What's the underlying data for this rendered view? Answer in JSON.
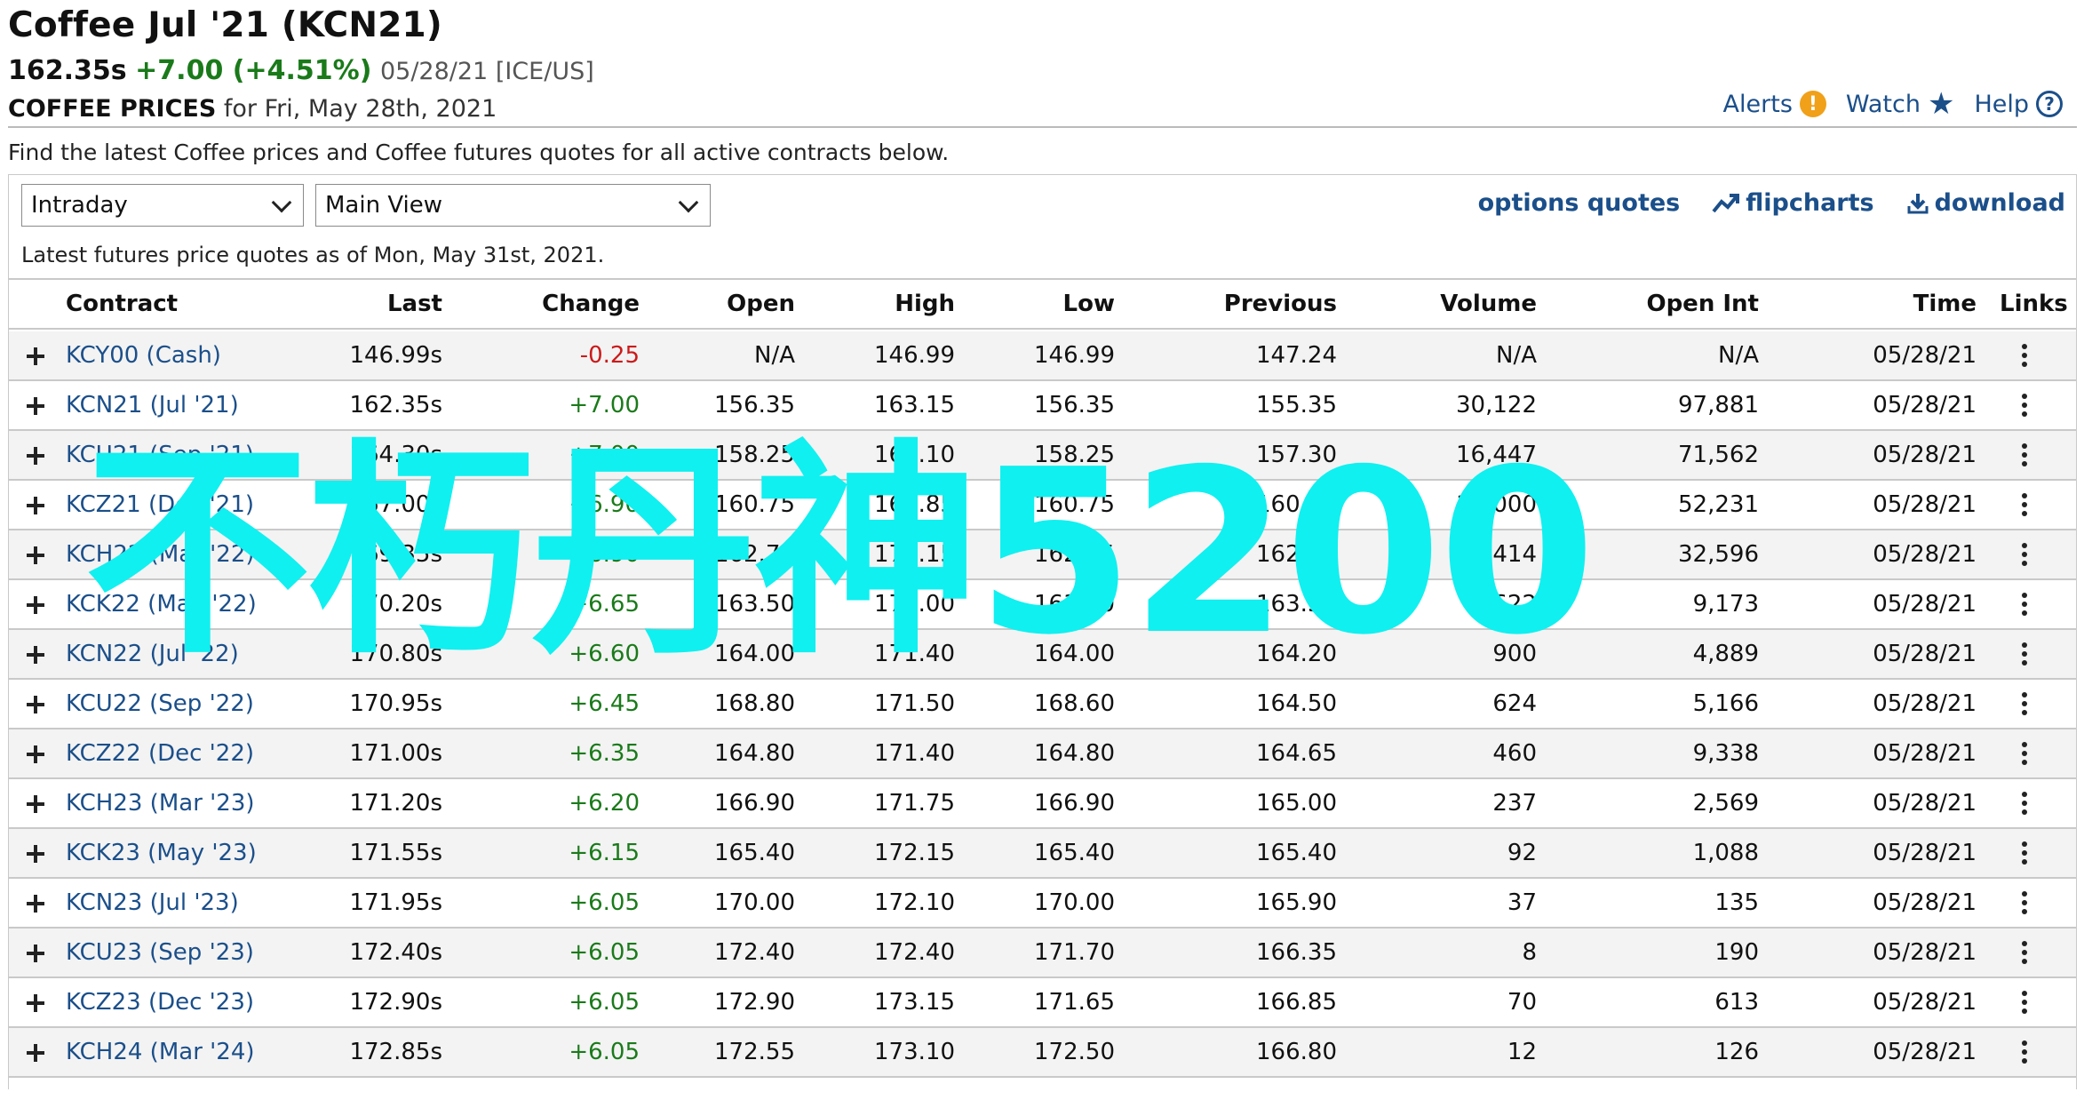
{
  "header": {
    "title": "Coffee Jul '21 (KCN21)",
    "last": "162.35s",
    "change": "+7.00 (+4.51%)",
    "meta": "05/28/21 [ICE/US]",
    "prices_label": "COFFEE PRICES",
    "prices_date": "for Fri, May 28th, 2021",
    "alerts_label": "Alerts",
    "alerts_glyph": "!",
    "watch_label": "Watch",
    "help_label": "Help",
    "help_glyph": "?",
    "description": "Find the latest Coffee prices and Coffee futures quotes for all active contracts below."
  },
  "controls": {
    "period_select": "Intraday",
    "view_select": "Main View",
    "options_quotes": "options quotes",
    "flipcharts": "flipcharts",
    "download": "download",
    "as_of": "Latest futures price quotes as of Mon, May 31st, 2021."
  },
  "colors": {
    "link_blue": "#1b4f8a",
    "positive": "#1a7a1a",
    "negative": "#cc1a1a",
    "alert_orange": "#f0a019",
    "watermark": "#10f0f0"
  },
  "table": {
    "columns": [
      "Contract",
      "Last",
      "Change",
      "Open",
      "High",
      "Low",
      "Previous",
      "Volume",
      "Open Int",
      "Time",
      "Links"
    ],
    "rows": [
      {
        "contract": "KCY00 (Cash)",
        "last": "146.99s",
        "change": "-0.25",
        "open": "N/A",
        "high": "146.99",
        "low": "146.99",
        "previous": "147.24",
        "volume": "N/A",
        "open_int": "N/A",
        "time": "05/28/21"
      },
      {
        "contract": "KCN21 (Jul '21)",
        "last": "162.35s",
        "change": "+7.00",
        "open": "156.35",
        "high": "163.15",
        "low": "156.35",
        "previous": "155.35",
        "volume": "30,122",
        "open_int": "97,881",
        "time": "05/28/21"
      },
      {
        "contract": "KCU21 (Sep '21)",
        "last": "164.30s",
        "change": "+7.00",
        "open": "158.25",
        "high": "165.10",
        "low": "158.25",
        "previous": "157.30",
        "volume": "16,447",
        "open_int": "71,562",
        "time": "05/28/21"
      },
      {
        "contract": "KCZ21 (Dec '21)",
        "last": "167.00s",
        "change": "+6.90",
        "open": "160.75",
        "high": "167.85",
        "low": "160.75",
        "previous": "160.10",
        "volume": "10,000",
        "open_int": "52,231",
        "time": "05/28/21"
      },
      {
        "contract": "KCH22 (Mar '22)",
        "last": "169.35s",
        "change": "+6.90",
        "open": "162.75",
        "high": "170.15",
        "low": "162.75",
        "previous": "162.45",
        "volume": "3,414",
        "open_int": "32,596",
        "time": "05/28/21"
      },
      {
        "contract": "KCK22 (May '22)",
        "last": "170.20s",
        "change": "+6.65",
        "open": "163.50",
        "high": "171.00",
        "low": "163.50",
        "previous": "163.50",
        "volume": "1,622",
        "open_int": "9,173",
        "time": "05/28/21"
      },
      {
        "contract": "KCN22 (Jul '22)",
        "last": "170.80s",
        "change": "+6.60",
        "open": "164.00",
        "high": "171.40",
        "low": "164.00",
        "previous": "164.20",
        "volume": "900",
        "open_int": "4,889",
        "time": "05/28/21"
      },
      {
        "contract": "KCU22 (Sep '22)",
        "last": "170.95s",
        "change": "+6.45",
        "open": "168.80",
        "high": "171.50",
        "low": "168.60",
        "previous": "164.50",
        "volume": "624",
        "open_int": "5,166",
        "time": "05/28/21"
      },
      {
        "contract": "KCZ22 (Dec '22)",
        "last": "171.00s",
        "change": "+6.35",
        "open": "164.80",
        "high": "171.40",
        "low": "164.80",
        "previous": "164.65",
        "volume": "460",
        "open_int": "9,338",
        "time": "05/28/21"
      },
      {
        "contract": "KCH23 (Mar '23)",
        "last": "171.20s",
        "change": "+6.20",
        "open": "166.90",
        "high": "171.75",
        "low": "166.90",
        "previous": "165.00",
        "volume": "237",
        "open_int": "2,569",
        "time": "05/28/21"
      },
      {
        "contract": "KCK23 (May '23)",
        "last": "171.55s",
        "change": "+6.15",
        "open": "165.40",
        "high": "172.15",
        "low": "165.40",
        "previous": "165.40",
        "volume": "92",
        "open_int": "1,088",
        "time": "05/28/21"
      },
      {
        "contract": "KCN23 (Jul '23)",
        "last": "171.95s",
        "change": "+6.05",
        "open": "170.00",
        "high": "172.10",
        "low": "170.00",
        "previous": "165.90",
        "volume": "37",
        "open_int": "135",
        "time": "05/28/21"
      },
      {
        "contract": "KCU23 (Sep '23)",
        "last": "172.40s",
        "change": "+6.05",
        "open": "172.40",
        "high": "172.40",
        "low": "171.70",
        "previous": "166.35",
        "volume": "8",
        "open_int": "190",
        "time": "05/28/21"
      },
      {
        "contract": "KCZ23 (Dec '23)",
        "last": "172.90s",
        "change": "+6.05",
        "open": "172.90",
        "high": "173.15",
        "low": "171.65",
        "previous": "166.85",
        "volume": "70",
        "open_int": "613",
        "time": "05/28/21"
      },
      {
        "contract": "KCH24 (Mar '24)",
        "last": "172.85s",
        "change": "+6.05",
        "open": "172.55",
        "high": "173.10",
        "low": "172.50",
        "previous": "166.80",
        "volume": "12",
        "open_int": "126",
        "time": "05/28/21"
      }
    ]
  },
  "watermark": "不朽丹神5200"
}
